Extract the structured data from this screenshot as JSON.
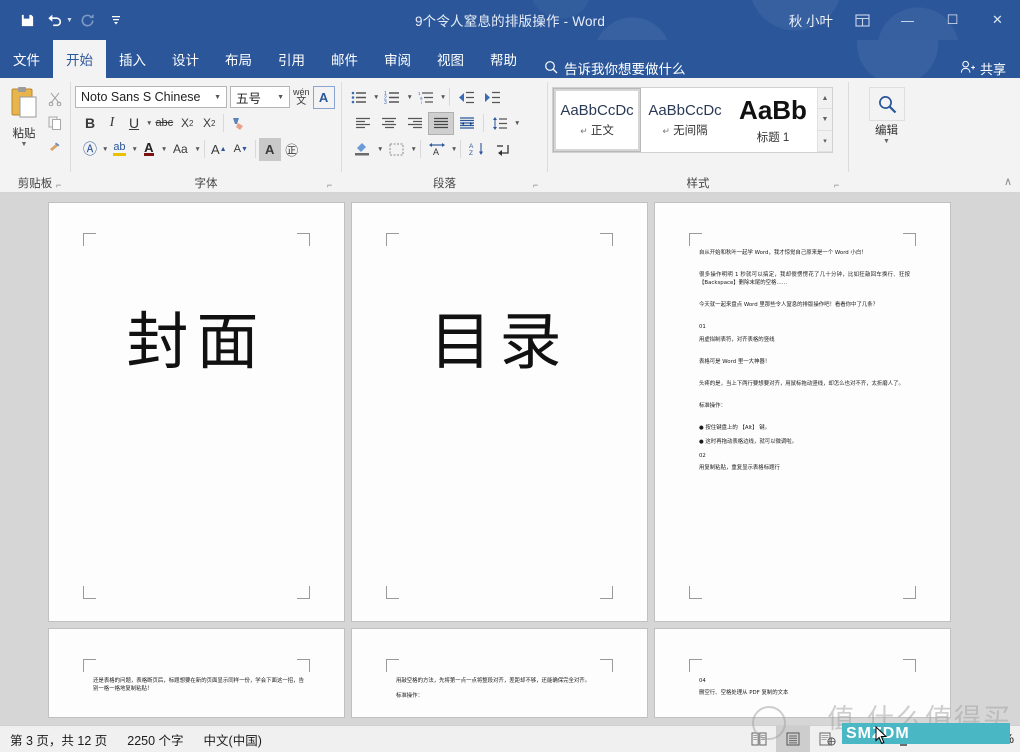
{
  "titlebar": {
    "document_title": "9个令人窒息的排版操作  -  Word",
    "user_name": "秋 小叶",
    "qat": [
      {
        "name": "save",
        "glyph": "💾"
      },
      {
        "name": "undo",
        "glyph": "↶"
      },
      {
        "name": "redo",
        "glyph": "↻"
      },
      {
        "name": "customize",
        "glyph": "☰"
      }
    ],
    "ribbon_display_options_icon": "ribbon-options-icon",
    "minimize": "—",
    "maximize": "☐",
    "close": "✕"
  },
  "tabs": [
    {
      "label": "文件",
      "active": false,
      "is_file": true
    },
    {
      "label": "开始",
      "active": true
    },
    {
      "label": "插入",
      "active": false
    },
    {
      "label": "设计",
      "active": false
    },
    {
      "label": "布局",
      "active": false
    },
    {
      "label": "引用",
      "active": false
    },
    {
      "label": "邮件",
      "active": false
    },
    {
      "label": "审阅",
      "active": false
    },
    {
      "label": "视图",
      "active": false
    },
    {
      "label": "帮助",
      "active": false
    }
  ],
  "tellme": {
    "placeholder": "告诉我你想要做什么",
    "icon": "search-icon"
  },
  "share": {
    "label": "共享",
    "icon": "person-add-icon"
  },
  "ribbon": {
    "clipboard": {
      "group_label": "剪贴板",
      "paste_label": "粘贴",
      "cut_title": "剪切",
      "copy_title": "复制",
      "format_painter_title": "格式刷"
    },
    "font": {
      "group_label": "字体",
      "font_name": "Noto Sans S Chinese",
      "font_size": "五号",
      "phonetic_guide": "wén",
      "char_border": "A",
      "bold": "B",
      "italic": "I",
      "underline": "U",
      "strikethrough": "abc",
      "subscript": "X₂",
      "superscript": "X²",
      "clear_format": "清除所有格式",
      "text_effects": "A",
      "highlight": "ab",
      "font_color": "A",
      "change_case": "Aa",
      "grow_font": "A",
      "shrink_font": "A",
      "char_shading": "A",
      "enclose_char": "字"
    },
    "paragraph": {
      "group_label": "段落",
      "bullets": "☰",
      "numbering": "☰",
      "multilevel": "☰",
      "decrease_indent": "←",
      "increase_indent": "→",
      "align_left": "≡",
      "align_center": "≡",
      "align_right": "≡",
      "justify": "≡",
      "distributed": "≡",
      "line_spacing": "↕",
      "shading": "▣",
      "borders": "▦",
      "asian_layout": "A",
      "sort": "AZ",
      "show_marks": "↵",
      "justify_active": true
    },
    "styles": {
      "group_label": "样式",
      "items": [
        {
          "preview": "AaBbCcDc",
          "name": "正文",
          "pilcrow": "↵",
          "selected": true,
          "heading": false
        },
        {
          "preview": "AaBbCcDc",
          "name": "无间隔",
          "pilcrow": "↵",
          "selected": false,
          "heading": false
        },
        {
          "preview": "AaBb",
          "name": "标题 1",
          "pilcrow": "",
          "selected": false,
          "heading": true
        }
      ],
      "scroll_up": "▲",
      "scroll_down": "▼",
      "more": "☰"
    },
    "editing": {
      "group_label": "编辑",
      "icon": "search-icon",
      "caret": "▾"
    },
    "collapse_ribbon": "∧"
  },
  "document": {
    "pages": [
      {
        "kind": "title",
        "big_text": "封面"
      },
      {
        "kind": "title",
        "big_text": "目录"
      },
      {
        "kind": "text",
        "paragraphs": [
          "自从开始和秋叶一起学 Word，我才惊觉自己原来是一个 Word 小白！",
          "很多操作明明 1 秒就可以搞定，我却傻愣愣花了几十分钟，比如狂敲回车换行、狂按 【Backspace】删除末尾的空格……",
          "今天就一起来盘点 Word 里那些令人窒息的排版操作吧！看看你中了几条？",
          "01",
          "用虚拟制表符，对齐表格的竖线",
          "表格可是 Word 里一大神器！",
          "头疼的是，当上下两行要想要对齐，用鼠标拖动竖线，却怎么也对不齐，太折磨人了。",
          "标准操作：",
          "● 按住键盘上的 【Alt】 键。",
          "● 这时再拖动表格边线，就可以微调啦。",
          "02",
          "用复制粘贴，重复显示表格标题行"
        ]
      },
      {
        "kind": "text-half",
        "paragraphs": [
          "还是表格的问题，表格断页后，标题想要在新的页面显示同样一份，学会下面这一招，告别一格一格地复制粘贴！"
        ]
      },
      {
        "kind": "text-half",
        "paragraphs": [
          "用敲空格的方法，先将第一点一点将整段对齐，差距却不够，还能确保完全对齐。",
          "标准操作："
        ]
      },
      {
        "kind": "text-half",
        "paragraphs": [
          "04",
          "删空行、空格处理从 PDF 复制的文本"
        ]
      }
    ]
  },
  "statusbar": {
    "page_info": "第 3 页，共 12 页",
    "word_count": "2250 个字",
    "language": "中文(中国)",
    "views": [
      {
        "name": "read-mode",
        "glyph": "📖",
        "active": false
      },
      {
        "name": "print-layout",
        "glyph": "☰",
        "active": true
      },
      {
        "name": "web-layout",
        "glyph": "🗒",
        "active": false
      }
    ],
    "zoom_out": "−",
    "zoom_in": "+",
    "zoom_value": "50%"
  },
  "watermark": {
    "text": "值 什么值得买",
    "banner": "SMZDM"
  },
  "colors": {
    "word_blue": "#2b579a",
    "ribbon_bg": "#f3f3f3",
    "doc_bg": "#d6d6d6",
    "status_bg": "#f0f0f0",
    "watermark_teal": "#49b7c4"
  }
}
